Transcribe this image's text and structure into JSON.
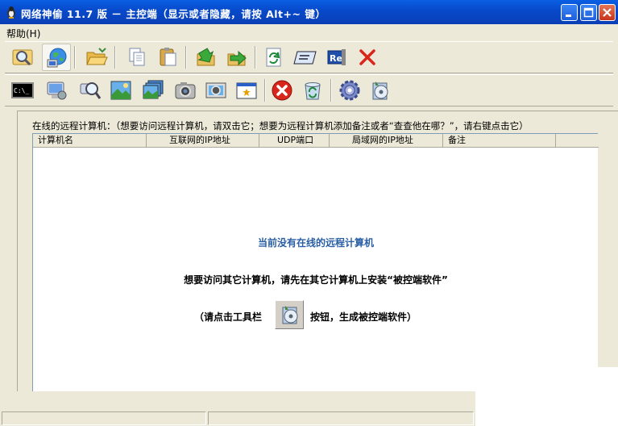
{
  "window": {
    "title": "网络神偷 11.7 版 － 主控端（显示或者隐藏，请按 Alt+~ 键）"
  },
  "menu": {
    "help": "帮助(H)"
  },
  "toolbar1": {
    "buttons": [
      "search-computers-icon",
      "network-globe-icon",
      "open-folder-icon",
      "copy-icon",
      "paste-icon",
      "download-icon",
      "upload-icon",
      "refresh-icon",
      "rename-icon",
      "registry-icon",
      "delete-icon"
    ]
  },
  "toolbar2": {
    "buttons": [
      "command-prompt-icon",
      "remote-computer-icon",
      "search-remote-icon",
      "screenshot-icon",
      "screen-monitor-icon",
      "webcam-icon",
      "video-capture-icon",
      "window-manager-icon",
      "stop-icon",
      "recycle-icon",
      "settings-icon",
      "generate-server-icon"
    ]
  },
  "panel": {
    "instruction": "在线的远程计算机：（想要访问远程计算机，请双击它；想要为远程计算机添加备注或者“查查他在哪？”，请右键点击它）",
    "columns": [
      "计算机名",
      "互联网的IP地址",
      "UDP端口",
      "局域网的IP地址",
      "备注"
    ]
  },
  "empty_state": {
    "line1": "当前没有在线的远程计算机",
    "line2": "想要访问其它计算机，请先在其它计算机上安装“被控端软件”",
    "line3_pre": "（请点击工具栏",
    "line3_post": "按钮，生成被控端软件）"
  },
  "colors": {
    "title_bar": "#0a4ec7",
    "accent": "#2a5fa5",
    "window_bg": "#ece9d8"
  }
}
